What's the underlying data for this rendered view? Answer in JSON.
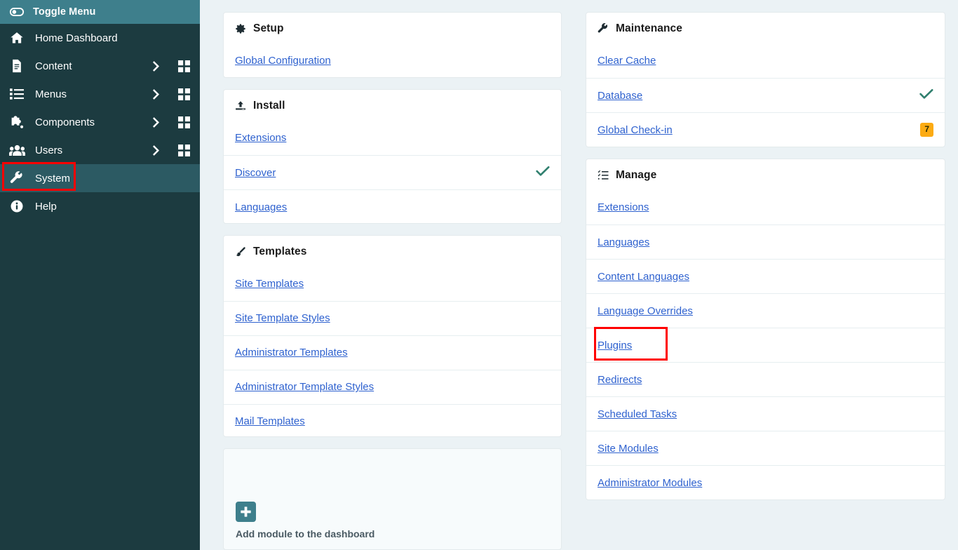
{
  "sidebar": {
    "toggle": {
      "label": "Toggle Menu",
      "icon": "toggle-icon"
    },
    "items": [
      {
        "label": "Home Dashboard",
        "icon": "home-icon",
        "has_arrow": false,
        "has_grid": false,
        "active": false
      },
      {
        "label": "Content",
        "icon": "document-icon",
        "has_arrow": true,
        "has_grid": true,
        "active": false
      },
      {
        "label": "Menus",
        "icon": "list-icon",
        "has_arrow": true,
        "has_grid": true,
        "active": false
      },
      {
        "label": "Components",
        "icon": "puzzle-icon",
        "has_arrow": true,
        "has_grid": true,
        "active": false
      },
      {
        "label": "Users",
        "icon": "users-icon",
        "has_arrow": true,
        "has_grid": true,
        "active": false
      },
      {
        "label": "System",
        "icon": "wrench-icon",
        "has_arrow": false,
        "has_grid": false,
        "active": true
      },
      {
        "label": "Help",
        "icon": "info-icon",
        "has_arrow": false,
        "has_grid": false,
        "active": false
      }
    ]
  },
  "cards": {
    "setup": {
      "title": "Setup",
      "icon": "gear-icon",
      "rows": [
        {
          "label": "Global Configuration",
          "check": false,
          "badge": null
        }
      ]
    },
    "install": {
      "title": "Install",
      "icon": "upload-icon",
      "rows": [
        {
          "label": "Extensions",
          "check": false,
          "badge": null
        },
        {
          "label": "Discover",
          "check": true,
          "badge": null
        },
        {
          "label": "Languages",
          "check": false,
          "badge": null
        }
      ]
    },
    "templates": {
      "title": "Templates",
      "icon": "paintbrush-icon",
      "rows": [
        {
          "label": "Site Templates",
          "check": false,
          "badge": null
        },
        {
          "label": "Site Template Styles",
          "check": false,
          "badge": null
        },
        {
          "label": "Administrator Templates",
          "check": false,
          "badge": null
        },
        {
          "label": "Administrator Template Styles",
          "check": false,
          "badge": null
        },
        {
          "label": "Mail Templates",
          "check": false,
          "badge": null
        }
      ]
    },
    "maintenance": {
      "title": "Maintenance",
      "icon": "wrench-icon",
      "rows": [
        {
          "label": "Clear Cache",
          "check": false,
          "badge": null
        },
        {
          "label": "Database",
          "check": true,
          "badge": null
        },
        {
          "label": "Global Check-in",
          "check": false,
          "badge": "7"
        }
      ]
    },
    "manage": {
      "title": "Manage",
      "icon": "tasks-list-icon",
      "rows": [
        {
          "label": "Extensions",
          "check": false,
          "badge": null
        },
        {
          "label": "Languages",
          "check": false,
          "badge": null
        },
        {
          "label": "Content Languages",
          "check": false,
          "badge": null
        },
        {
          "label": "Language Overrides",
          "check": false,
          "badge": null
        },
        {
          "label": "Plugins",
          "check": false,
          "badge": null,
          "highlighted": true
        },
        {
          "label": "Redirects",
          "check": false,
          "badge": null
        },
        {
          "label": "Scheduled Tasks",
          "check": false,
          "badge": null
        },
        {
          "label": "Site Modules",
          "check": false,
          "badge": null
        },
        {
          "label": "Administrator Modules",
          "check": false,
          "badge": null
        }
      ]
    }
  },
  "add_module": {
    "label": "Add module to the dashboard",
    "icon": "plus-icon"
  },
  "colors": {
    "sidebar_bg": "#1c3b40",
    "sidebar_header_bg": "#3e7f8c",
    "sidebar_active_bg": "#2c5a63",
    "page_bg": "#ebf2f5",
    "link": "#2f62cf",
    "check": "#2f7f6e",
    "badge": "#fcab13",
    "highlight": "#ff0000"
  }
}
